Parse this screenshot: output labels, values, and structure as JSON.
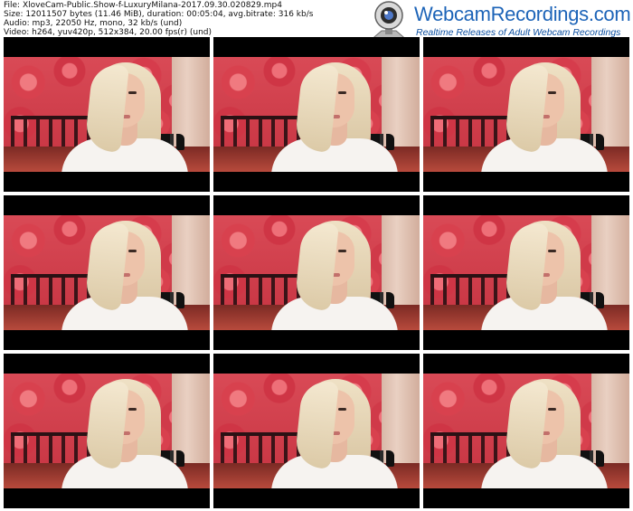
{
  "info": {
    "file": "File: XloveCam-Public.Show-f-LuxuryMilana-2017.09.30.020829.mp4",
    "size": "Size: 12011507 bytes (11.46 MiB), duration: 00:05:04, avg.bitrate: 316 kb/s",
    "audio": "Audio: mp3, 22050 Hz, mono, 32 kb/s (und)",
    "video": "Video: h264, yuv420p, 512x384, 20.00 fps(r) (und)"
  },
  "logo": {
    "title": "WebcamRecordings.com",
    "subtitle": "Realtime Releases of Adult Webcam Recordings",
    "icon": "webcam-icon",
    "color": "#1d64b8"
  },
  "thumbnails": [
    {
      "id": 1
    },
    {
      "id": 2
    },
    {
      "id": 3
    },
    {
      "id": 4
    },
    {
      "id": 5
    },
    {
      "id": 6
    },
    {
      "id": 7
    },
    {
      "id": 8
    },
    {
      "id": 9
    }
  ]
}
